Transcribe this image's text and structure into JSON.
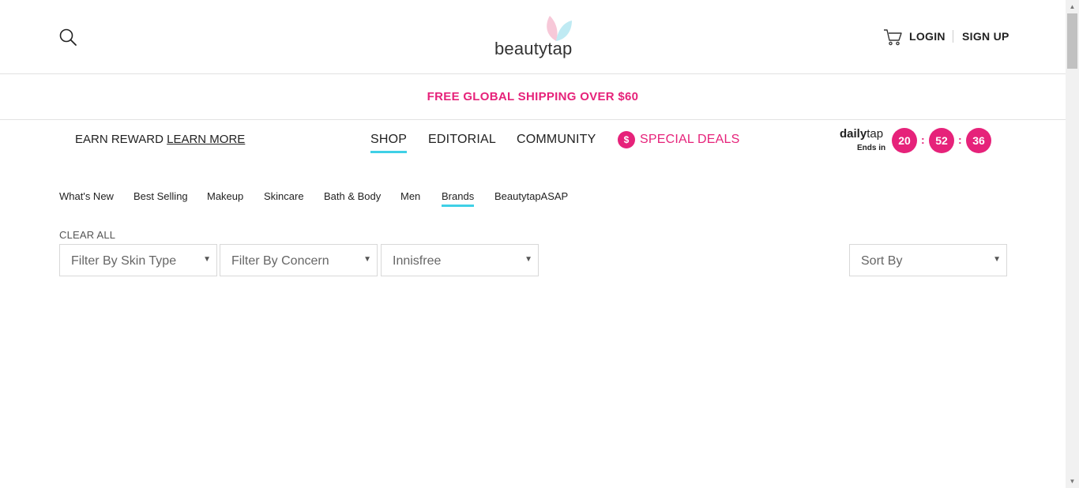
{
  "header": {
    "logo_text": "beautytap",
    "login": "LOGIN",
    "signup": "SIGN UP"
  },
  "promo": {
    "text": "FREE GLOBAL SHIPPING OVER $60"
  },
  "nav": {
    "earn_label": "EARN REWARD",
    "learn_more": "LEARN MORE",
    "shop": "SHOP",
    "editorial": "EDITORIAL",
    "community": "COMMUNITY",
    "deal_icon": "$",
    "special_deals": "SPECIAL DEALS"
  },
  "timer": {
    "brand_bold": "daily",
    "brand_light": "tap",
    "ends_in": "Ends in",
    "hours": "20",
    "minutes": "52",
    "seconds": "36",
    "colon": ":"
  },
  "categories": [
    {
      "label": "What's New"
    },
    {
      "label": "Best Selling"
    },
    {
      "label": "Makeup"
    },
    {
      "label": "Skincare"
    },
    {
      "label": "Bath & Body"
    },
    {
      "label": "Men"
    },
    {
      "label": "Brands"
    },
    {
      "label": "BeautytapASAP"
    }
  ],
  "filters": {
    "clear_all": "CLEAR ALL",
    "skin_type": "Filter By Skin Type",
    "concern": "Filter By Concern",
    "brand": "Innisfree",
    "sort": "Sort By",
    "arrow": "▼"
  },
  "colors": {
    "accent_pink": "#e6227a",
    "accent_cyan": "#3fd0e6"
  },
  "icons": [
    "search-icon",
    "cart-icon",
    "logo-leaf-icon",
    "dollar-icon",
    "chevron-down-icon"
  ]
}
